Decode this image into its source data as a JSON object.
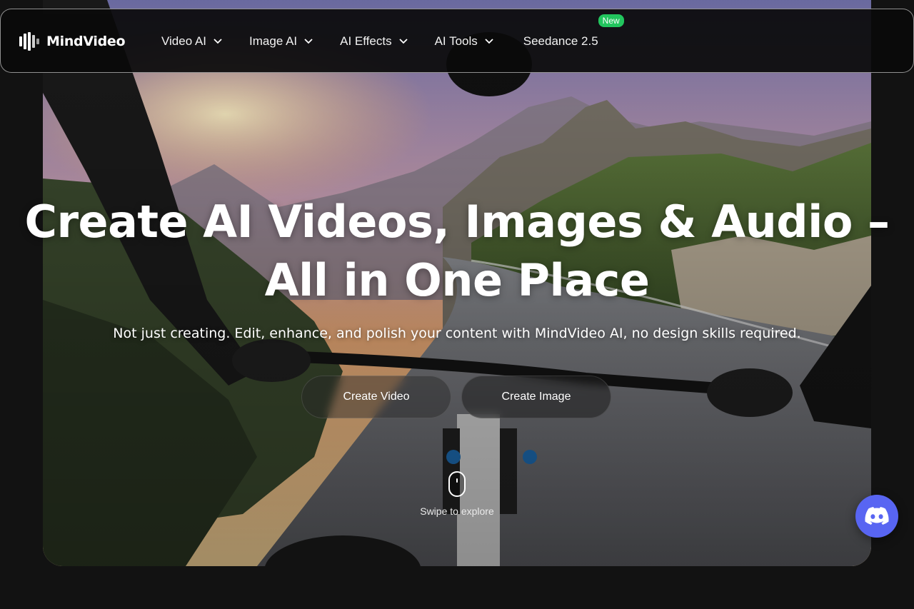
{
  "brand": {
    "name": "MindVideo",
    "logo_icon": "mindvideo-logo-icon"
  },
  "nav": {
    "items": [
      {
        "label": "Video AI",
        "icon": "chevron-down-icon"
      },
      {
        "label": "Image AI",
        "icon": "chevron-down-icon"
      },
      {
        "label": "AI Effects",
        "icon": "chevron-down-icon"
      },
      {
        "label": "AI Tools",
        "icon": "chevron-down-icon"
      },
      {
        "label": "Seedance 2.5",
        "badge": "New"
      }
    ]
  },
  "hero": {
    "headline_line1": "Create AI Videos, Images & Audio –",
    "headline_line2": "All in One Place",
    "subheadline": "Not just creating. Edit, enhance, and polish your content with MindVideo AI, no design skills required.",
    "cta_primary": "Create Video",
    "cta_secondary": "Create Image",
    "swipe_label": "Swipe to explore"
  },
  "floating": {
    "discord_icon": "discord-icon"
  },
  "colors": {
    "background": "#121212",
    "badge": "#22c55e",
    "discord": "#5865f2"
  }
}
